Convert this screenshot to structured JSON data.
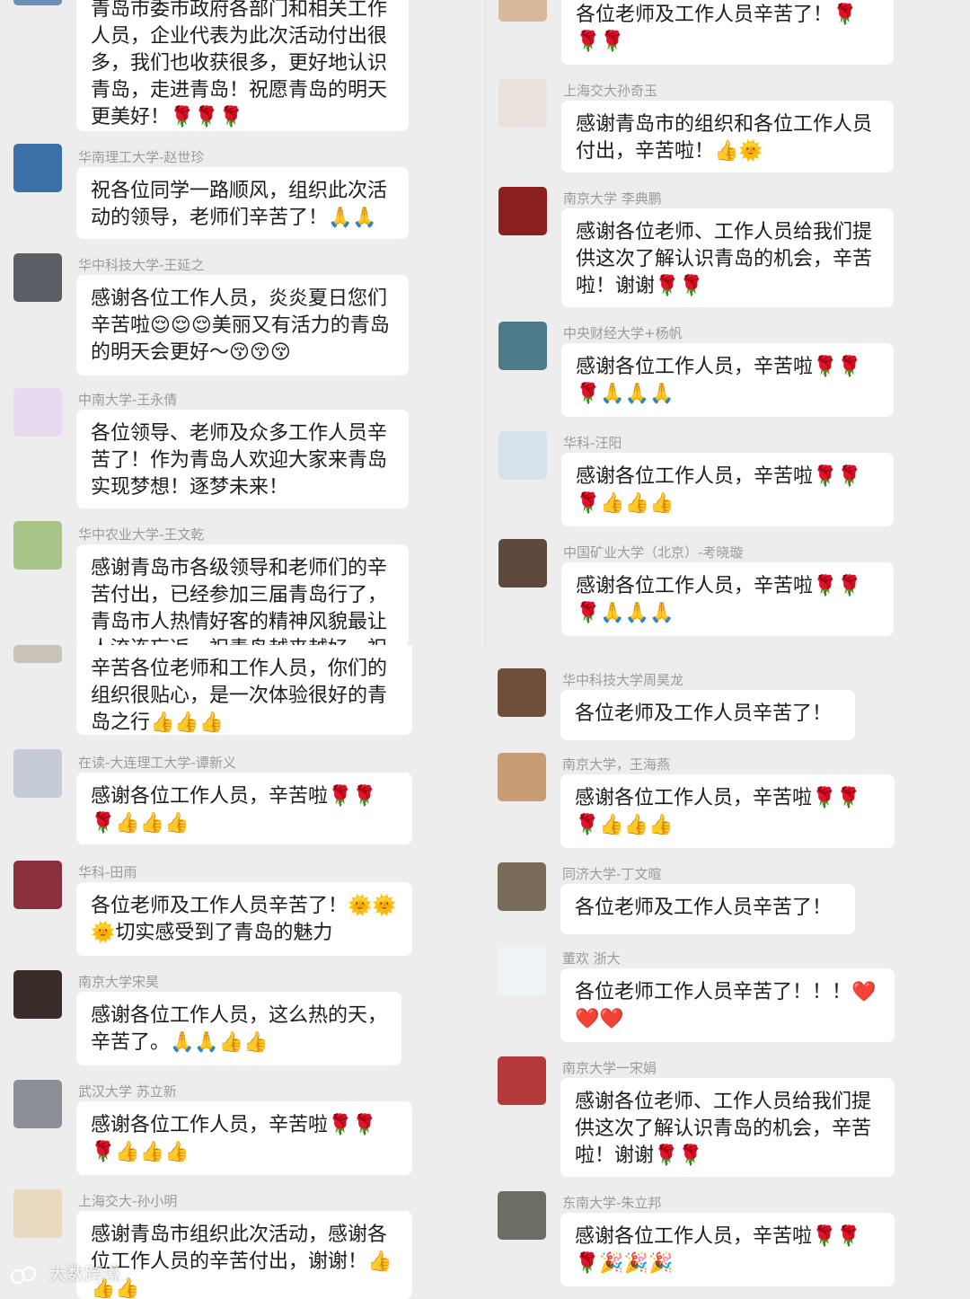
{
  "left_messages": [
    {
      "sender": "",
      "text": "青岛市委市政府各部门和相关工作人员，企业代表为此次活动付出很多，我们也收获很多，更好地认识青岛，走进青岛！祝愿青岛的明天更美好！🌹🌹🌹"
    },
    {
      "sender": "华南理工大学-赵世珍",
      "text": "祝各位同学一路顺风，组织此次活动的领导，老师们辛苦了！🙏🙏"
    },
    {
      "sender": "华中科技大学-王延之",
      "text": "感谢各位工作人员，炎炎夏日您们辛苦啦😌😌😌美丽又有活力的青岛的明天会更好～😚😚😚"
    },
    {
      "sender": "中南大学-王永倩",
      "text": "各位领导、老师及众多工作人员辛苦了！作为青岛人欢迎大家来青岛实现梦想！逐梦未来！"
    },
    {
      "sender": "华中农业大学-王文乾",
      "text": "感谢青岛市各级领导和老师们的辛苦付出，已经参加三届青岛行了，青岛市人热情好客的精神风貌最让人流连忘返，祝青岛越来越好，祝"
    },
    {
      "sender": "",
      "text": "辛苦各位老师和工作人员，你们的组织很贴心，是一次体验很好的青岛之行👍👍👍"
    },
    {
      "sender": "在读-大连理工大学-谭新义",
      "text": "感谢各位工作人员，辛苦啦🌹🌹🌹👍👍👍"
    },
    {
      "sender": "华科-田雨",
      "text": "各位老师及工作人员辛苦了！🌞🌞🌞切实感受到了青岛的魅力"
    },
    {
      "sender": "南京大学宋昊",
      "text": "感谢各位工作人员，这么热的天，辛苦了。🙏🙏👍👍"
    },
    {
      "sender": "武汉大学 苏立新",
      "text": "感谢各位工作人员，辛苦啦🌹🌹🌹👍👍👍"
    },
    {
      "sender": "上海交大-孙小明",
      "text": "感谢青岛市组织此次活动，感谢各位工作人员的辛苦付出，谢谢！👍👍👍"
    }
  ],
  "right_messages": [
    {
      "sender": "",
      "text": "各位老师及工作人员辛苦了！🌹🌹🌹"
    },
    {
      "sender": "上海交大孙奇玉",
      "text": "感谢青岛市的组织和各位工作人员付出，辛苦啦！👍🌞"
    },
    {
      "sender": "南京大学 李典鹏",
      "text": "感谢各位老师、工作人员给我们提供这次了解认识青岛的机会，辛苦啦！谢谢🌹🌹"
    },
    {
      "sender": "中央财经大学+杨帆",
      "text": "感谢各位工作人员，辛苦啦🌹🌹🌹🙏🙏🙏"
    },
    {
      "sender": "华科-汪阳",
      "text": "感谢各位工作人员，辛苦啦🌹🌹🌹👍👍👍"
    },
    {
      "sender": "中国矿业大学（北京）-考晓璇",
      "text": "感谢各位工作人员，辛苦啦🌹🌹🌹🙏🙏🙏"
    },
    {
      "sender": "华中科技大学周昊龙",
      "text": "各位老师及工作人员辛苦了！"
    },
    {
      "sender": "南京大学，王海燕",
      "text": "感谢各位工作人员，辛苦啦🌹🌹🌹👍👍👍"
    },
    {
      "sender": "同济大学-丁文暄",
      "text": "各位老师及工作人员辛苦了！"
    },
    {
      "sender": "董欢 浙大",
      "text": "各位老师工作人员辛苦了！！！❤️❤️❤️"
    },
    {
      "sender": "南京大学一宋娟",
      "text": "感谢各位老师、工作人员给我们提供这次了解认识青岛的机会，辛苦啦！谢谢🌹🌹"
    },
    {
      "sender": "东南大学-朱立邦",
      "text": "感谢各位工作人员，辛苦啦🌹🌹🌹🎉🎉🎉"
    }
  ],
  "watermark": {
    "text": "大数跨境"
  },
  "avatar_colors": {
    "left": [
      "#6a8fb8",
      "#3b6fa8",
      "#5a5f66",
      "#e7d9f0",
      "#a9c489",
      "#c9c2b8",
      "#c6ccd6",
      "#8a2f3c",
      "#3a2c28",
      "#8c8f95",
      "#e8d9c0"
    ],
    "right": [
      "#d9b89a",
      "#e9e2dc",
      "#8c1f1f",
      "#4d7a88",
      "#d6e2ea",
      "#5e4a3c",
      "#6f4f3a",
      "#c89c74",
      "#7a6a58",
      "#f0f3f6",
      "#b53a3a",
      "#6b6f63"
    ]
  }
}
